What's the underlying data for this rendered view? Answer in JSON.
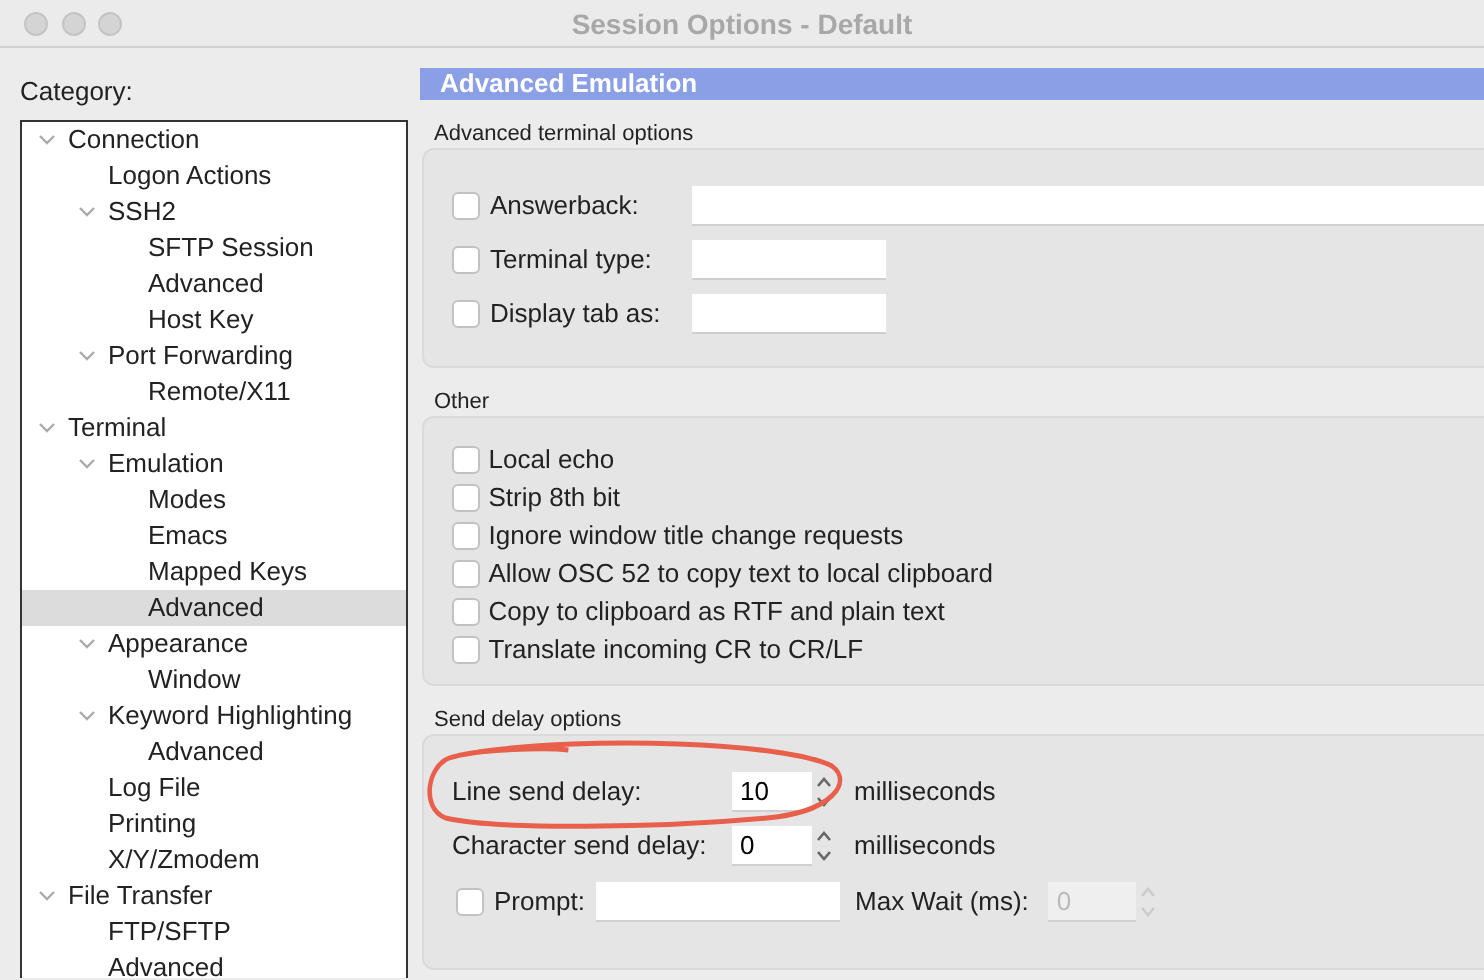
{
  "window": {
    "title": "Session Options - Default"
  },
  "category_label": "Category:",
  "tree": [
    {
      "label": "Connection",
      "selected": false,
      "expanded": true,
      "children": [
        {
          "label": "Logon Actions",
          "selected": false
        },
        {
          "label": "SSH2",
          "selected": false,
          "expanded": true,
          "children": [
            {
              "label": "SFTP Session",
              "selected": false
            },
            {
              "label": "Advanced",
              "selected": false
            },
            {
              "label": "Host Key",
              "selected": false
            }
          ]
        },
        {
          "label": "Port Forwarding",
          "selected": false,
          "expanded": true,
          "children": [
            {
              "label": "Remote/X11",
              "selected": false
            }
          ]
        }
      ]
    },
    {
      "label": "Terminal",
      "selected": false,
      "expanded": true,
      "children": [
        {
          "label": "Emulation",
          "selected": false,
          "expanded": true,
          "children": [
            {
              "label": "Modes",
              "selected": false
            },
            {
              "label": "Emacs",
              "selected": false
            },
            {
              "label": "Mapped Keys",
              "selected": false
            },
            {
              "label": "Advanced",
              "selected": true
            }
          ]
        },
        {
          "label": "Appearance",
          "selected": false,
          "expanded": true,
          "children": [
            {
              "label": "Window",
              "selected": false
            }
          ]
        },
        {
          "label": "Keyword Highlighting",
          "selected": false,
          "expanded": true,
          "children": [
            {
              "label": "Advanced",
              "selected": false
            }
          ]
        },
        {
          "label": "Log File",
          "selected": false
        },
        {
          "label": "Printing",
          "selected": false
        },
        {
          "label": "X/Y/Zmodem",
          "selected": false
        }
      ]
    },
    {
      "label": "File Transfer",
      "selected": false,
      "expanded": true,
      "children": [
        {
          "label": "FTP/SFTP",
          "selected": false
        },
        {
          "label": "Advanced",
          "selected": false
        }
      ]
    }
  ],
  "panel_title": "Advanced Emulation",
  "terminal_options": {
    "title": "Advanced terminal options",
    "items": [
      {
        "label": "Answerback:",
        "checked": false
      },
      {
        "label": "Terminal type:",
        "checked": false
      },
      {
        "label": "Display tab as:",
        "checked": false
      }
    ]
  },
  "other": {
    "title": "Other",
    "items": [
      {
        "label": "Local echo",
        "checked": false
      },
      {
        "label": "Strip 8th bit",
        "checked": false
      },
      {
        "label": "Ignore window title change requests",
        "checked": false
      },
      {
        "label": "Allow OSC 52 to copy text to local clipboard",
        "checked": false
      },
      {
        "label": "Copy to clipboard as RTF and plain text",
        "checked": false
      },
      {
        "label": "Translate incoming CR to CR/LF",
        "checked": false
      }
    ]
  },
  "send_delay": {
    "title": "Send delay options",
    "line_delay": {
      "label": "Line send delay:",
      "value": "10",
      "unit": "milliseconds"
    },
    "char_delay": {
      "label": "Character send delay:",
      "value": "0",
      "unit": "milliseconds"
    },
    "prompt": {
      "label": "Prompt:",
      "checked": false
    },
    "max_wait": {
      "label": "Max Wait (ms):",
      "value": "0",
      "disabled": true
    }
  },
  "annotation": {
    "kind": "ellipse",
    "color": "#e8604c"
  }
}
